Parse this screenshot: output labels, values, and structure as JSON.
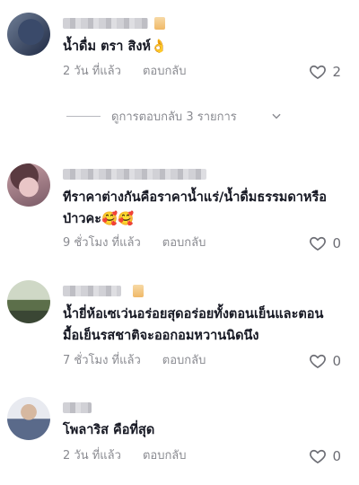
{
  "comments": [
    {
      "text": "น้ำดื่ม ตรา สิงห์👌",
      "time": "2 วัน ที่แล้ว",
      "reply_label": "ตอบกลับ",
      "likes": "2"
    },
    {
      "text": "ทีราคาต่างกันคือราคาน้ำแร่/น้ำดื่มธรรมดาหรือป่าวคะ🥰🥰",
      "time": "9 ชั่วโมง ที่แล้ว",
      "reply_label": "ตอบกลับ",
      "likes": "0"
    },
    {
      "text": "น้ำยี่ห้อเซเว่นอร่อยสุดอร่อยทั้งตอนเย็นและตอนมื้อเย็นรสชาติจะออกอมหวานนิดนึง",
      "time": "7 ชั่วโมง ที่แล้ว",
      "reply_label": "ตอบกลับ",
      "likes": "0"
    },
    {
      "text": "โพลาริส คือที่สุด",
      "time": "2 วัน ที่แล้ว",
      "reply_label": "ตอบกลับ",
      "likes": "0"
    }
  ],
  "view_replies": {
    "label": "ดูการตอบกลับ 3 รายการ"
  },
  "icons": {
    "like": "heart-outline-icon",
    "expand": "chevron-down-icon"
  },
  "colors": {
    "text": "#161823",
    "meta": "#8a8b91",
    "likes": "#6d6e75"
  }
}
